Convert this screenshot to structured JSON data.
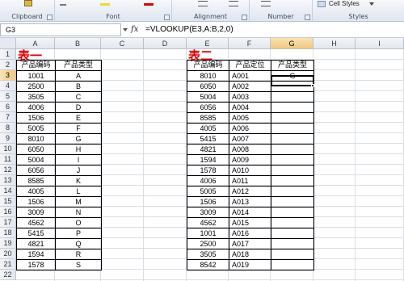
{
  "ribbon": {
    "groups": [
      {
        "label": "Clipboard"
      },
      {
        "label": "Font"
      },
      {
        "label": "Alignment"
      },
      {
        "label": "Number"
      },
      {
        "label": "Styles"
      }
    ],
    "cell_styles_label": "Cell Styles",
    "colors": {
      "font_red": "#e00000",
      "accent_yellow": "#f3c777"
    }
  },
  "formula_bar": {
    "name_box": "G3",
    "fx_label": "fx",
    "formula": "=VLOOKUP(E3,A:B,2,0)"
  },
  "columns": [
    "A",
    "B",
    "C",
    "D",
    "E",
    "F",
    "G",
    "H",
    "I"
  ],
  "selected_column": "G",
  "rows": [
    "1",
    "2",
    "3",
    "4",
    "5",
    "6",
    "7",
    "8",
    "9",
    "10",
    "11",
    "12",
    "13",
    "14",
    "15",
    "16",
    "17",
    "18",
    "19",
    "20",
    "21",
    "22"
  ],
  "selected_row": "3",
  "table1": {
    "title": "表一",
    "headers": [
      "产品编码",
      "产品类型"
    ],
    "rows": [
      [
        "1001",
        "A"
      ],
      [
        "2500",
        "B"
      ],
      [
        "3505",
        "C"
      ],
      [
        "4006",
        "D"
      ],
      [
        "1506",
        "E"
      ],
      [
        "5005",
        "F"
      ],
      [
        "8010",
        "G"
      ],
      [
        "6050",
        "H"
      ],
      [
        "5004",
        "I"
      ],
      [
        "6056",
        "J"
      ],
      [
        "8585",
        "K"
      ],
      [
        "4005",
        "L"
      ],
      [
        "1506",
        "M"
      ],
      [
        "3009",
        "N"
      ],
      [
        "4562",
        "O"
      ],
      [
        "5415",
        "P"
      ],
      [
        "4821",
        "Q"
      ],
      [
        "1594",
        "R"
      ],
      [
        "1578",
        "S"
      ]
    ]
  },
  "table2": {
    "title": "表二",
    "headers": [
      "产品编码",
      "产品定位",
      "产品类型"
    ],
    "rows": [
      [
        "8010",
        "A001",
        "G"
      ],
      [
        "6050",
        "A002",
        ""
      ],
      [
        "5004",
        "A003",
        ""
      ],
      [
        "6056",
        "A004",
        ""
      ],
      [
        "8585",
        "A005",
        ""
      ],
      [
        "4005",
        "A006",
        ""
      ],
      [
        "5415",
        "A007",
        ""
      ],
      [
        "4821",
        "A008",
        ""
      ],
      [
        "1594",
        "A009",
        ""
      ],
      [
        "1578",
        "A010",
        ""
      ],
      [
        "4006",
        "A011",
        ""
      ],
      [
        "5005",
        "A012",
        ""
      ],
      [
        "1506",
        "A013",
        ""
      ],
      [
        "3009",
        "A014",
        ""
      ],
      [
        "4562",
        "A015",
        ""
      ],
      [
        "1001",
        "A016",
        ""
      ],
      [
        "2500",
        "A017",
        ""
      ],
      [
        "3505",
        "A018",
        ""
      ],
      [
        "8542",
        "A019",
        ""
      ]
    ]
  }
}
